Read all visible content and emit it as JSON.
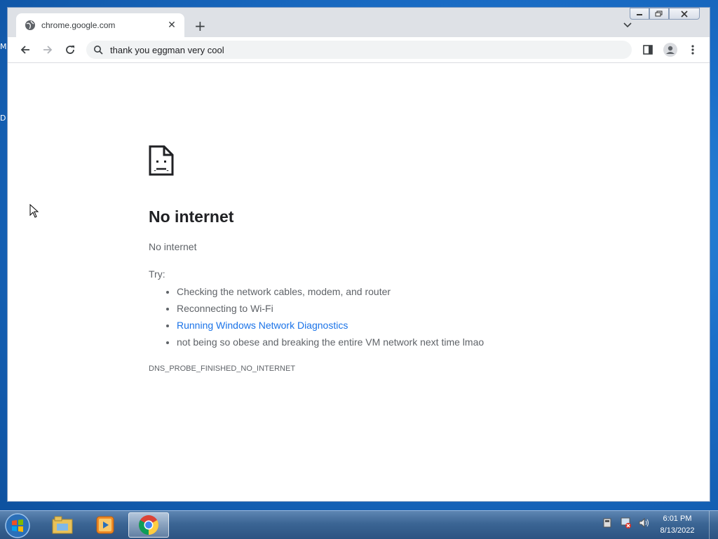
{
  "desktop": {
    "partial_icon_labels": [
      "M",
      "D"
    ]
  },
  "browser": {
    "tab": {
      "title": "chrome.google.com",
      "close_symbol": "✕"
    },
    "new_tab_symbol": "+",
    "omnibox": {
      "text": "thank you eggman very cool"
    }
  },
  "error_page": {
    "title": "No internet",
    "subtitle": "No internet",
    "try_label": "Try:",
    "suggestions": [
      {
        "text": "Checking the network cables, modem, and router",
        "link": false
      },
      {
        "text": "Reconnecting to Wi-Fi",
        "link": false
      },
      {
        "text": "Running Windows Network Diagnostics",
        "link": true
      },
      {
        "text": "not being so obese and breaking the entire VM network next time lmao",
        "link": false
      }
    ],
    "error_code": "DNS_PROBE_FINISHED_NO_INTERNET"
  },
  "taskbar": {
    "time": "6:01 PM",
    "date": "8/13/2022",
    "pinned": [
      "windows-explorer-icon",
      "media-player-icon",
      "chrome-icon"
    ]
  },
  "colors": {
    "link": "#1a73e8",
    "text": "#5f6368",
    "heading": "#202124"
  }
}
